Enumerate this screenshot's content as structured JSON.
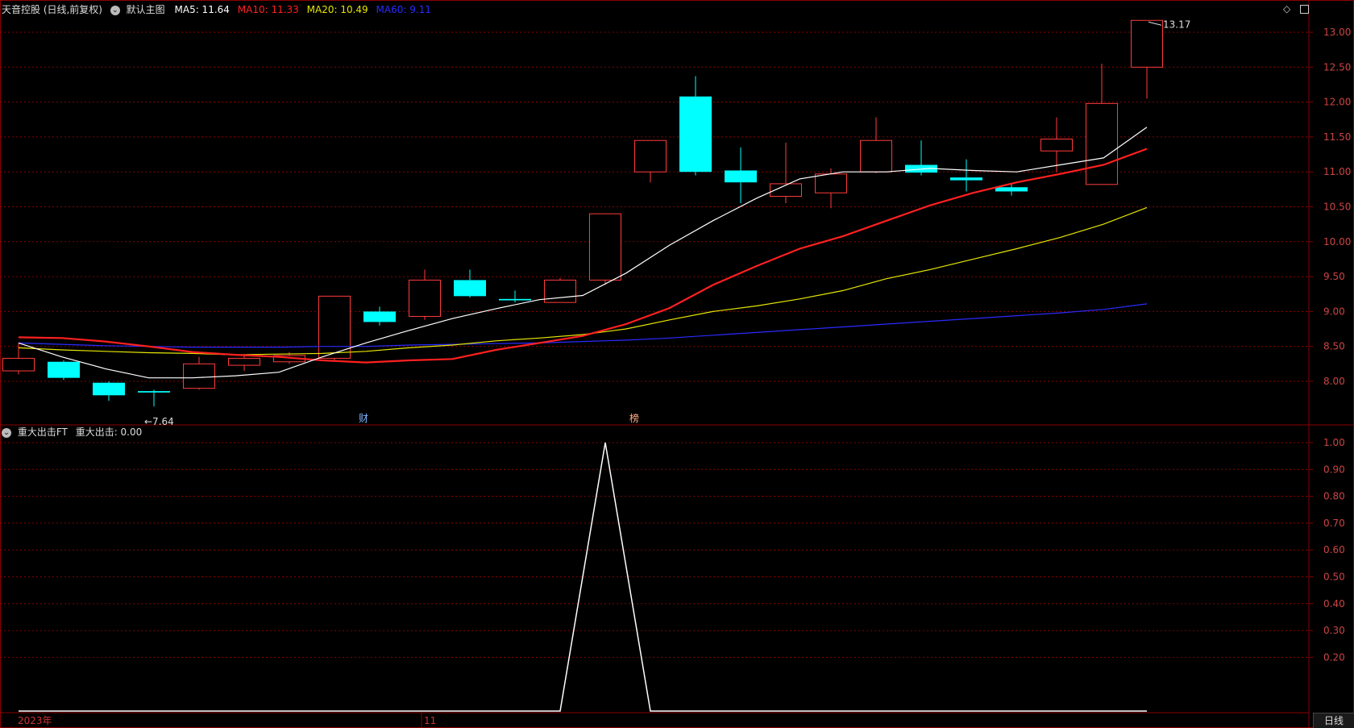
{
  "header": {
    "stock_title": "天音控股 (日线,前复权)",
    "main_chart_label": "默认主图",
    "ma5": "MA5: 11.64",
    "ma10": "MA10: 11.33",
    "ma20": "MA20: 10.49",
    "ma60": "MA60: 9.11"
  },
  "indicator_header": {
    "name": "重大出击FT",
    "value": "重大出击: 0.00"
  },
  "colors": {
    "up": "#ff3b3b",
    "down": "#00ffff",
    "ma5": "#ffffff",
    "ma10": "#ff2020",
    "ma20": "#e6e600",
    "ma60": "#2a2aff",
    "grid": "#8b0000",
    "axis_text": "#cc3333"
  },
  "x_axis": {
    "year_label": "2023年",
    "month_label": "11"
  },
  "bottom_tab": "日线",
  "markers": [
    {
      "label": "财",
      "index": 8
    },
    {
      "label": "榜",
      "index": 14
    }
  ],
  "annotations": {
    "high": "13.17",
    "low": "7.64"
  },
  "chart_data": {
    "type": "candlestick",
    "price_axis": {
      "ticks": [
        "13.00",
        "12.50",
        "12.00",
        "11.50",
        "11.00",
        "10.50",
        "10.00",
        "9.50",
        "9.00",
        "8.50",
        "8.00"
      ],
      "range": [
        7.55,
        13.2
      ]
    },
    "indicator_axis": {
      "ticks": [
        "1.00",
        "0.90",
        "0.80",
        "0.70",
        "0.60",
        "0.50",
        "0.40",
        "0.30",
        "0.20"
      ],
      "range": [
        0,
        1
      ]
    },
    "candles": [
      {
        "o": 8.15,
        "c": 8.33,
        "h": 8.55,
        "l": 8.1
      },
      {
        "o": 8.28,
        "c": 8.05,
        "h": 8.3,
        "l": 8.02
      },
      {
        "o": 7.98,
        "c": 7.8,
        "h": 8.0,
        "l": 7.72
      },
      {
        "o": 7.86,
        "c": 7.84,
        "h": 7.88,
        "l": 7.64
      },
      {
        "o": 7.9,
        "c": 8.25,
        "h": 8.35,
        "l": 7.88
      },
      {
        "o": 8.23,
        "c": 8.33,
        "h": 8.38,
        "l": 8.15
      },
      {
        "o": 8.28,
        "c": 8.37,
        "h": 8.42,
        "l": 8.25
      },
      {
        "o": 8.33,
        "c": 9.22,
        "h": 9.22,
        "l": 8.3
      },
      {
        "o": 9.0,
        "c": 8.85,
        "h": 9.07,
        "l": 8.8
      },
      {
        "o": 8.93,
        "c": 9.45,
        "h": 9.6,
        "l": 8.88
      },
      {
        "o": 9.45,
        "c": 9.22,
        "h": 9.6,
        "l": 9.2
      },
      {
        "o": 9.18,
        "c": 9.16,
        "h": 9.3,
        "l": 9.13
      },
      {
        "o": 9.13,
        "c": 9.45,
        "h": 9.48,
        "l": 9.13
      },
      {
        "o": 9.45,
        "c": 10.4,
        "h": 10.4,
        "l": 9.38
      },
      {
        "o": 11.0,
        "c": 11.45,
        "h": 11.45,
        "l": 10.85
      },
      {
        "o": 12.08,
        "c": 11.0,
        "h": 12.37,
        "l": 10.95
      },
      {
        "o": 11.02,
        "c": 10.85,
        "h": 11.35,
        "l": 10.55
      },
      {
        "o": 10.65,
        "c": 10.83,
        "h": 11.42,
        "l": 10.55
      },
      {
        "o": 10.7,
        "c": 10.97,
        "h": 11.05,
        "l": 10.48
      },
      {
        "o": 11.0,
        "c": 11.45,
        "h": 11.78,
        "l": 10.98
      },
      {
        "o": 11.1,
        "c": 10.99,
        "h": 11.45,
        "l": 10.95
      },
      {
        "o": 10.92,
        "c": 10.88,
        "h": 11.18,
        "l": 10.72
      },
      {
        "o": 10.78,
        "c": 10.72,
        "h": 10.82,
        "l": 10.66
      },
      {
        "o": 11.3,
        "c": 11.47,
        "h": 11.78,
        "l": 11.0
      },
      {
        "o": 10.82,
        "c": 11.98,
        "h": 12.55,
        "l": 10.82
      },
      {
        "o": 12.5,
        "c": 13.17,
        "h": 13.17,
        "l": 12.05
      }
    ],
    "ma5": [
      8.55,
      8.35,
      8.18,
      8.05,
      8.05,
      8.08,
      8.13,
      8.35,
      8.55,
      8.73,
      8.9,
      9.04,
      9.17,
      9.23,
      9.55,
      9.95,
      10.3,
      10.62,
      10.9,
      11.0,
      11.0,
      11.05,
      11.02,
      11.0,
      11.1,
      11.2,
      11.64
    ],
    "ma10": [
      8.63,
      8.62,
      8.57,
      8.5,
      8.42,
      8.38,
      8.35,
      8.3,
      8.27,
      8.3,
      8.32,
      8.45,
      8.55,
      8.65,
      8.82,
      9.05,
      9.38,
      9.65,
      9.9,
      10.08,
      10.3,
      10.52,
      10.7,
      10.85,
      10.97,
      11.1,
      11.33
    ],
    "ma20": [
      8.48,
      8.45,
      8.43,
      8.41,
      8.4,
      8.38,
      8.39,
      8.4,
      8.43,
      8.48,
      8.52,
      8.58,
      8.62,
      8.67,
      8.75,
      8.88,
      9.0,
      9.08,
      9.18,
      9.3,
      9.47,
      9.6,
      9.75,
      9.9,
      10.06,
      10.25,
      10.49
    ],
    "ma60": [
      8.55,
      8.53,
      8.51,
      8.5,
      8.49,
      8.49,
      8.49,
      8.5,
      8.5,
      8.52,
      8.53,
      8.54,
      8.55,
      8.57,
      8.59,
      8.62,
      8.66,
      8.7,
      8.74,
      8.78,
      8.82,
      8.86,
      8.9,
      8.94,
      8.98,
      9.03,
      9.11
    ],
    "indicator": [
      0,
      0,
      0,
      0,
      0,
      0,
      0,
      0,
      0,
      0,
      0,
      0,
      0,
      1,
      0,
      0,
      0,
      0,
      0,
      0,
      0,
      0,
      0,
      0,
      0,
      0
    ]
  }
}
